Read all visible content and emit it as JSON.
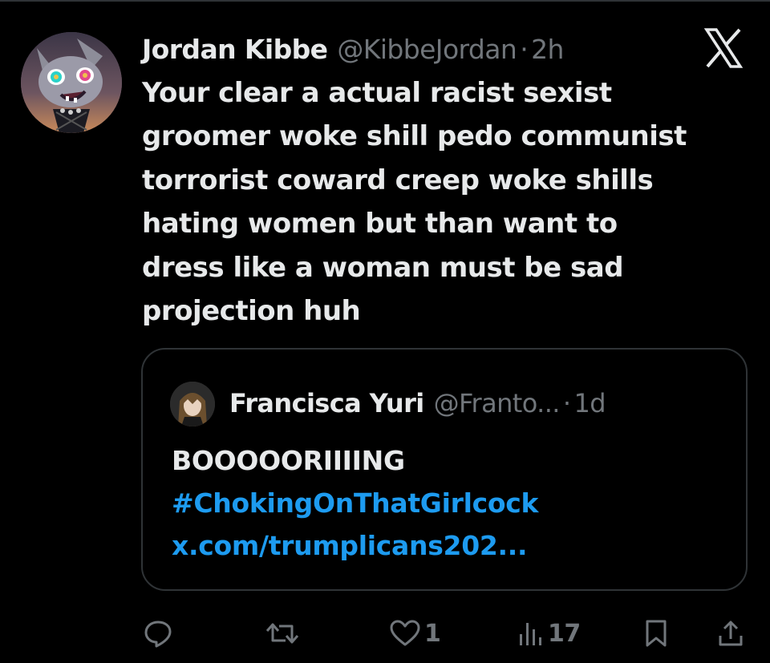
{
  "tweet": {
    "author": {
      "name": "Jordan Kibbe",
      "handle": "@KibbeJordan",
      "avatar_icon": "cartoon-character-avatar"
    },
    "separator": "·",
    "time": "2h",
    "platform_icon": "x-logo-icon",
    "text": "Your clear a actual racist sexist\ngroomer woke shill pedo communist\ntorrorist coward creep woke shills\nhating women but than want to\ndress like a woman must be sad\nprojection huh"
  },
  "quote": {
    "author": {
      "name": "Francisca Yuri",
      "handle": "@Franto...",
      "avatar_icon": "anime-character-avatar"
    },
    "separator": "·",
    "time": "1d",
    "lines": {
      "text": "BOOOOORIIIING",
      "hashtag": "#ChokingOnThatGirlcock",
      "link": "x.com/trumplicans202..."
    }
  },
  "actions": {
    "reply": {
      "icon": "reply-icon",
      "count": ""
    },
    "repost": {
      "icon": "repost-icon",
      "count": ""
    },
    "like": {
      "icon": "heart-icon",
      "count": "1"
    },
    "views": {
      "icon": "views-icon",
      "count": "17"
    },
    "bookmark": {
      "icon": "bookmark-icon"
    },
    "share": {
      "icon": "share-icon"
    }
  },
  "colors": {
    "background": "#000000",
    "text": "#e7e9ea",
    "muted": "#71767b",
    "link": "#1d9bf0",
    "border": "#2f3336"
  }
}
